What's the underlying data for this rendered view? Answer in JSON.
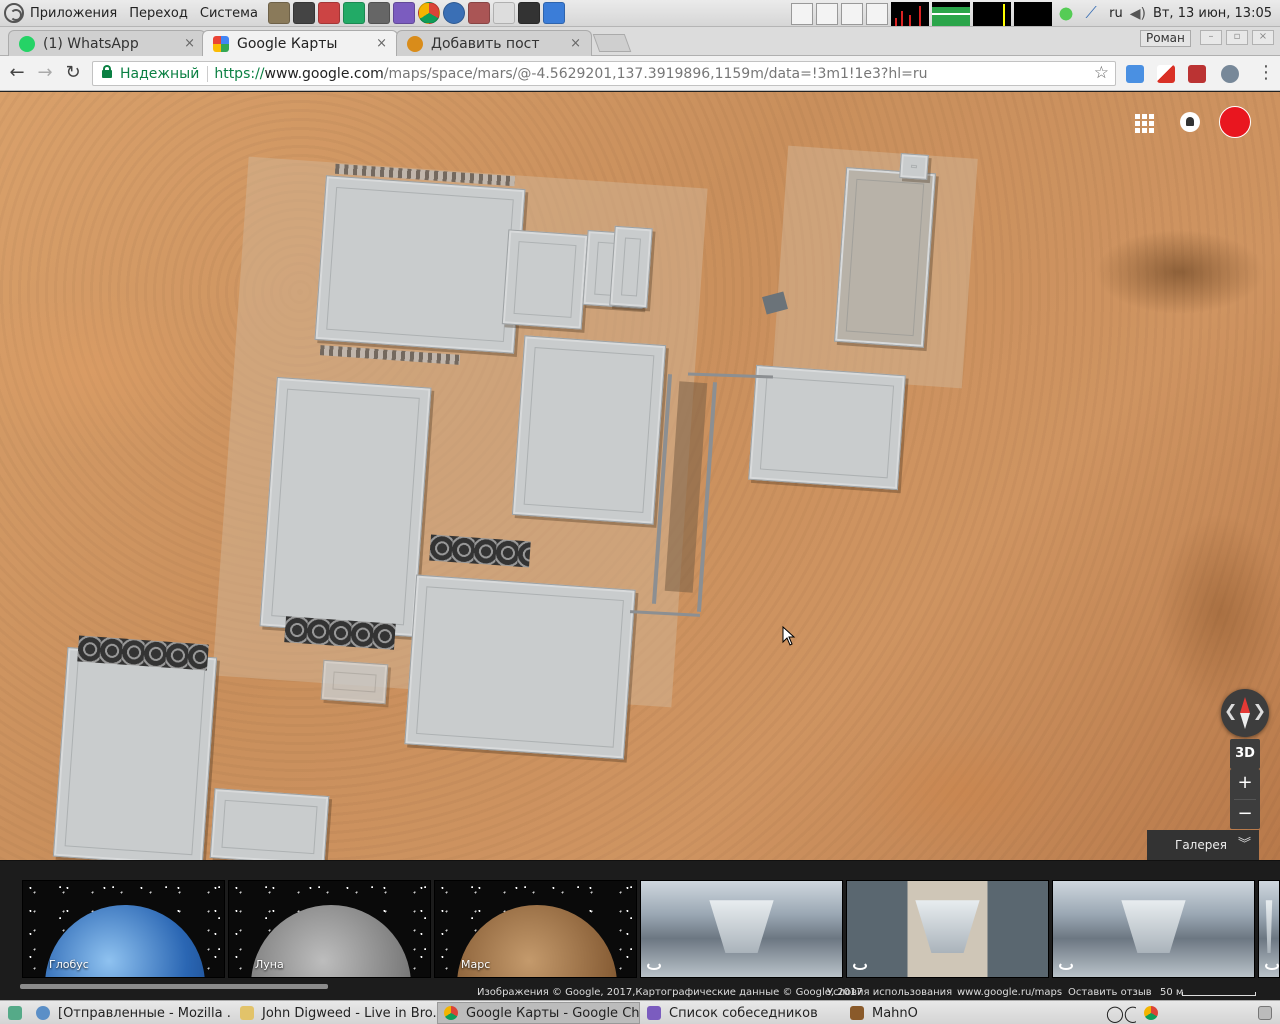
{
  "desktop": {
    "menu": [
      "Приложения",
      "Переход",
      "Система"
    ],
    "lang": "ru",
    "clock": "Вт, 13 июн, 13:05"
  },
  "browser": {
    "tabs": [
      {
        "label": "(1) WhatsApp",
        "icon": "whatsapp-icon",
        "color": "#25d366"
      },
      {
        "label": "Google Карты",
        "icon": "google-maps-icon",
        "color": "#4285f4"
      },
      {
        "label": "Добавить пост",
        "icon": "blog-icon",
        "color": "#d98c1a"
      }
    ],
    "close_glyph": "×",
    "user": "Роман",
    "security_label": "Надежный",
    "url": {
      "scheme": "https://",
      "host": "www.google.com",
      "path": "/maps/space/mars/@-4.5629201,137.3919896,1159m/data=!3m1!1e3?hl=ru"
    },
    "star_glyph": "☆",
    "menu_glyph": "⋮"
  },
  "map": {
    "compass_arrows": [
      "❮",
      "❯"
    ],
    "btn_3d": "3D",
    "zoom_in": "+",
    "zoom_out": "−",
    "gallery": "Галерея",
    "gallery_chevron": "︾"
  },
  "filmstrip": {
    "thumbs": [
      {
        "label": "Глобус"
      },
      {
        "label": "Луна"
      },
      {
        "label": "Марс"
      }
    ]
  },
  "attribution": {
    "copyright": "Изображения © Google, 2017,Картографические данные © Google, 2017",
    "terms": "Условия использования",
    "site": "www.google.ru/maps",
    "feedback": "Оставить отзыв",
    "scale": "50 м"
  },
  "taskbar": {
    "tasks": [
      {
        "label": "[Отправленные - Mozilla ...",
        "color": "#5b8fc7"
      },
      {
        "label": "John Digweed - Live in Bro...",
        "color": "#e2c36a"
      },
      {
        "label": "Google Карты - Google Ch...",
        "color": "#e8a22a"
      },
      {
        "label": "Список собеседников",
        "color": "#7b5cbf"
      },
      {
        "label": "MahnO",
        "color": "#8a5a2a"
      }
    ]
  },
  "colors": {
    "mars_ground": "#c98f5c",
    "avatar": "#e9161f",
    "secure_green": "#0b8043"
  }
}
